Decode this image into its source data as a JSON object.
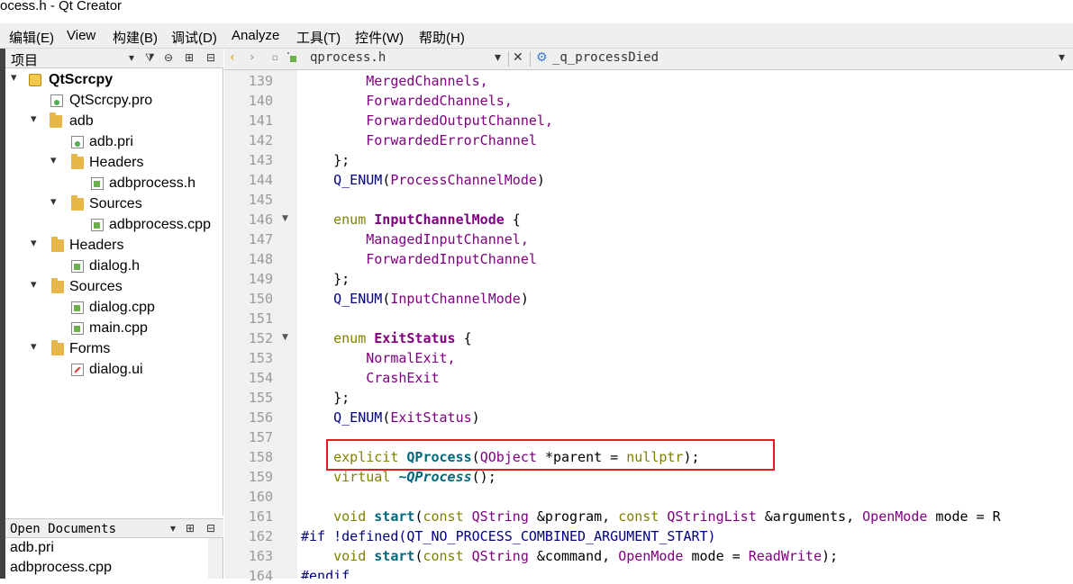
{
  "window": {
    "title": "ocess.h - Qt Creator"
  },
  "menu": [
    "编辑(E)",
    "View",
    "构建(B)",
    "调试(D)",
    "Analyze",
    "工具(T)",
    "控件(W)",
    "帮助(H)"
  ],
  "project_panel": {
    "title": "项目",
    "tree": [
      {
        "label": "QtScrcpy",
        "bold": true,
        "icon": "project-icon",
        "expanded": true
      },
      {
        "label": "QtScrcpy.pro",
        "icon": "pro-file-icon"
      },
      {
        "label": "adb",
        "icon": "folder-icon",
        "expanded": true
      },
      {
        "label": "adb.pri",
        "icon": "pri-file-icon"
      },
      {
        "label": "Headers",
        "icon": "headers-folder-icon",
        "expanded": true
      },
      {
        "label": "adbprocess.h",
        "icon": "header-file-icon"
      },
      {
        "label": "Sources",
        "icon": "sources-folder-icon",
        "expanded": true
      },
      {
        "label": "adbprocess.cpp",
        "icon": "cpp-file-icon"
      },
      {
        "label": "Headers",
        "icon": "headers-folder-icon",
        "expanded": true
      },
      {
        "label": "dialog.h",
        "icon": "header-file-icon"
      },
      {
        "label": "Sources",
        "icon": "sources-folder-icon",
        "expanded": true
      },
      {
        "label": "dialog.cpp",
        "icon": "cpp-file-icon"
      },
      {
        "label": "main.cpp",
        "icon": "cpp-file-icon"
      },
      {
        "label": "Forms",
        "icon": "forms-folder-icon",
        "expanded": true
      },
      {
        "label": "dialog.ui",
        "icon": "ui-file-icon"
      }
    ]
  },
  "open_documents": {
    "title": "Open Documents",
    "items": [
      "adb.pri",
      "adbprocess.cpp"
    ]
  },
  "editor_toolbar": {
    "file": "qprocess.h",
    "symbol": "_q_processDied"
  },
  "editor": {
    "line_numbers": [
      "139",
      "140",
      "141",
      "142",
      "143",
      "144",
      "145",
      "146",
      "147",
      "148",
      "149",
      "150",
      "151",
      "152",
      "153",
      "154",
      "155",
      "156",
      "157",
      "158",
      "159",
      "160",
      "161",
      "162",
      "163",
      "164"
    ],
    "fold_markers": [
      "146",
      "152"
    ],
    "highlight_color": "#e31b23",
    "code": {
      "l139": "MergedChannels,",
      "l140": "ForwardedChannels,",
      "l141": "ForwardedOutputChannel,",
      "l142": "ForwardedErrorChannel",
      "l143": "};",
      "l144_macro": "Q_ENUM",
      "l144_arg": "ProcessChannelMode",
      "l146_kw": "enum",
      "l146_name": "InputChannelMode",
      "l147": "ManagedInputChannel,",
      "l148": "ForwardedInputChannel",
      "l149": "};",
      "l150_macro": "Q_ENUM",
      "l150_arg": "InputChannelMode",
      "l152_kw": "enum",
      "l152_name": "ExitStatus",
      "l153": "NormalExit,",
      "l154": "CrashExit",
      "l155": "};",
      "l156_macro": "Q_ENUM",
      "l156_arg": "ExitStatus",
      "l158_kw": "explicit",
      "l158_fn": "QProcess",
      "l158_type": "QObject",
      "l158_param": "*parent = ",
      "l158_null": "nullptr",
      "l158_end": ");",
      "l159_kw": "virtual",
      "l159_fn": "~QProcess",
      "l159_end": "();",
      "l161_kw": "void",
      "l161_fn": "start",
      "l161_const1": "const",
      "l161_t1": "QString",
      "l161_p1": " &program, ",
      "l161_const2": "const",
      "l161_t2": "QStringList",
      "l161_p2": " &arguments, ",
      "l161_t3": "OpenMode",
      "l161_p3": " mode = R",
      "l162_pp": "#if !defined",
      "l162_mac": "(QT_NO_PROCESS_COMBINED_ARGUMENT_START)",
      "l163_kw": "void",
      "l163_fn": "start",
      "l163_const": "const",
      "l163_t1": "QString",
      "l163_p1": " &command, ",
      "l163_t2": "OpenMode",
      "l163_p2": " mode = ",
      "l163_val": "ReadWrite",
      "l163_end": ");",
      "l164": "#endif"
    }
  }
}
